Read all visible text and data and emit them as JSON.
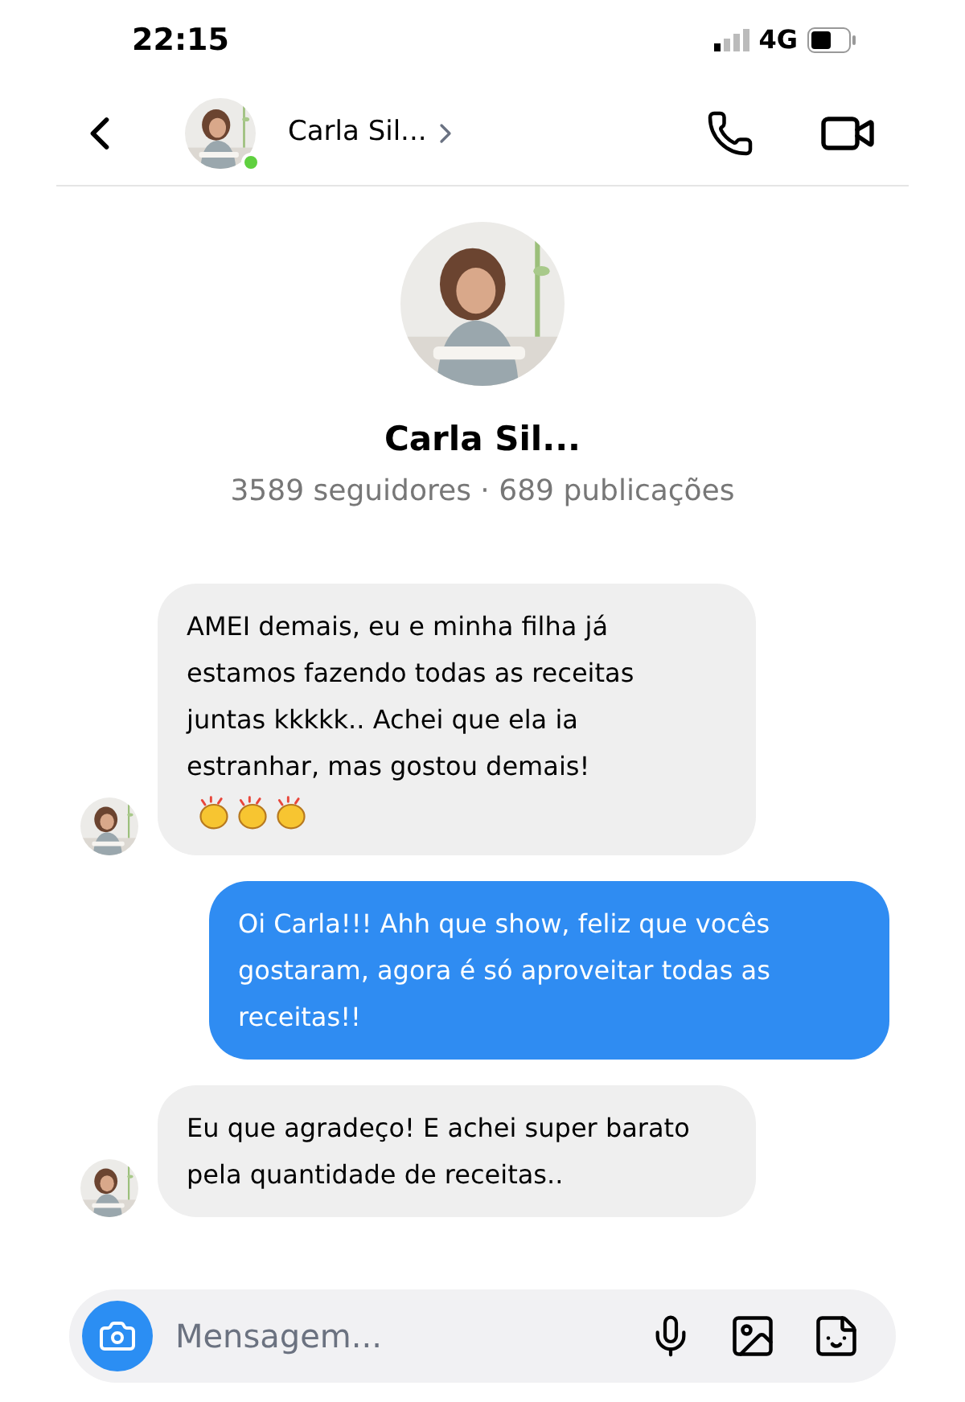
{
  "status_bar": {
    "time": "22:15",
    "network": "4G"
  },
  "header": {
    "name": "Carla Sil...",
    "online": true
  },
  "profile": {
    "name": "Carla Sil...",
    "stats": "3589 seguidores · 689 publicações"
  },
  "messages": [
    {
      "kind": "received",
      "text": "AMEI demais, eu e minha filha já estamos fazendo todas as receitas juntas kkkkk.. Achei que ela ia estranhar, mas gostou demais!",
      "clap_icons": true
    },
    {
      "kind": "sent",
      "text": "Oi Carla!!! Ahh que show, feliz que vocês gostaram, agora é só aproveitar todas as receitas!!"
    },
    {
      "kind": "received",
      "text": "Eu que agradeço! E achei super barato pela quantidade de receitas.."
    }
  ],
  "composer": {
    "placeholder": "Mensagem..."
  }
}
